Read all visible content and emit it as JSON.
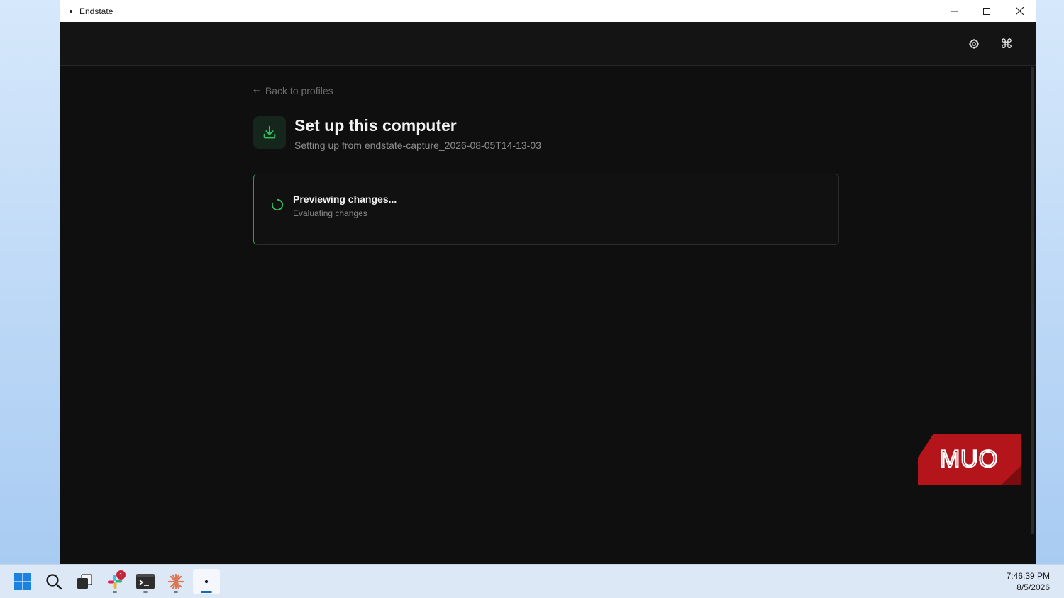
{
  "window": {
    "title": "Endstate"
  },
  "header": {
    "settings_icon": "gear-icon",
    "command_icon": "command-icon",
    "command_glyph": "⌘"
  },
  "page": {
    "back_arrow": "←",
    "back_label": "Back to profiles",
    "title": "Set up this computer",
    "subtitle": "Setting up from endstate-capture_2026-08-05T14-13-03",
    "accent_color": "#22a24e"
  },
  "status": {
    "title": "Previewing changes...",
    "subtitle": "Evaluating changes"
  },
  "watermark": {
    "text": "MUO"
  },
  "taskbar": {
    "items": [
      {
        "name": "start",
        "icon": "windows-icon"
      },
      {
        "name": "search",
        "icon": "search-icon"
      },
      {
        "name": "task-view",
        "icon": "task-view-icon"
      },
      {
        "name": "slack",
        "icon": "slack-icon",
        "badge": "1"
      },
      {
        "name": "terminal",
        "icon": "terminal-icon"
      },
      {
        "name": "claude",
        "icon": "claude-icon"
      },
      {
        "name": "endstate",
        "icon": "endstate-icon",
        "active": true
      }
    ],
    "time": "7:46:39 PM",
    "date": "8/5/2026"
  }
}
